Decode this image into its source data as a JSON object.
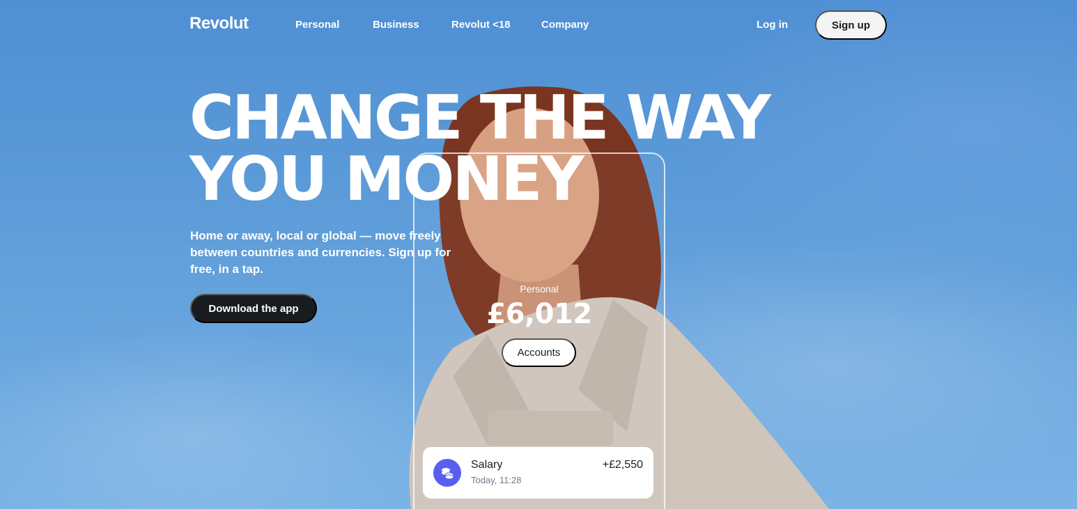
{
  "brand": {
    "logo_text": "Revolut"
  },
  "nav": {
    "links": [
      "Personal",
      "Business",
      "Revolut <18",
      "Company"
    ],
    "login_label": "Log in",
    "signup_label": "Sign up"
  },
  "hero": {
    "headline": "CHANGE THE WAY YOU MONEY",
    "subtitle": "Home or away, local or global — move freely between countries and currencies. Sign up for free, in a tap.",
    "cta_label": "Download the app"
  },
  "phone": {
    "account_label": "Personal",
    "balance": "£6,012",
    "accounts_button": "Accounts",
    "transaction": {
      "name": "Salary",
      "time": "Today, 11:28",
      "amount": "+£2,550",
      "icon": "coins-icon"
    }
  },
  "colors": {
    "sky": "#5b9ad8",
    "dark_button": "#191c1f",
    "light_button": "#f4f4f4",
    "tx_icon": "#5a5ef0"
  }
}
